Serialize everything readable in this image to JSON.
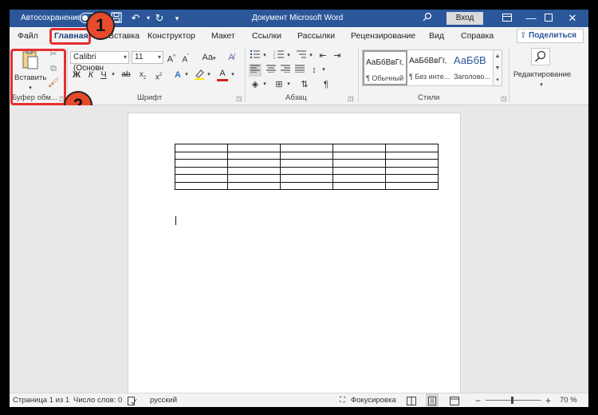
{
  "titlebar": {
    "autosave_label": "Автосохранение",
    "document_title": "Документ Microsoft Word",
    "signin_label": "Вход",
    "icons": [
      "save-icon",
      "undo-icon",
      "redo-icon",
      "search-icon",
      "ribbon-display-icon",
      "minimize-icon",
      "maximize-icon",
      "close-icon"
    ]
  },
  "tabs": [
    {
      "label": "Файл"
    },
    {
      "label": "Главная"
    },
    {
      "label": "Вставка"
    },
    {
      "label": "Конструктор"
    },
    {
      "label": "Макет"
    },
    {
      "label": "Ссылки"
    },
    {
      "label": "Рассылки"
    },
    {
      "label": "Рецензирование"
    },
    {
      "label": "Вид"
    },
    {
      "label": "Справка"
    }
  ],
  "share_label": "Поделиться",
  "ribbon": {
    "clipboard": {
      "label": "Буфер обм...",
      "paste_label": "Вставить"
    },
    "font": {
      "label": "Шрифт",
      "font_name": "Calibri (Основн",
      "font_size": "11",
      "bold": "Ж",
      "italic": "К",
      "underline": "Ч",
      "case_label": "Aa"
    },
    "paragraph": {
      "label": "Абзац"
    },
    "styles": {
      "label": "Стили",
      "items": [
        {
          "sample": "АаБбВвГг,",
          "name": "¶ Обычный"
        },
        {
          "sample": "АаБбВвГг,",
          "name": "¶ Без инте..."
        },
        {
          "sample": "АаБбВ",
          "name": "Заголово..."
        }
      ]
    },
    "editing": {
      "label": "Редактирование"
    }
  },
  "annotations": [
    "1",
    "2"
  ],
  "document": {
    "table": {
      "rows": 6,
      "cols": 5
    }
  },
  "statusbar": {
    "page": "Страница 1 из 1",
    "words": "Число слов: 0",
    "language": "русский",
    "focus": "Фокусировка",
    "zoom_minus": "−",
    "zoom_plus": "+",
    "zoom": "70 %"
  },
  "colors": {
    "accent": "#2b579a",
    "highlight": "#e53030",
    "badge": "#e84a2c"
  }
}
